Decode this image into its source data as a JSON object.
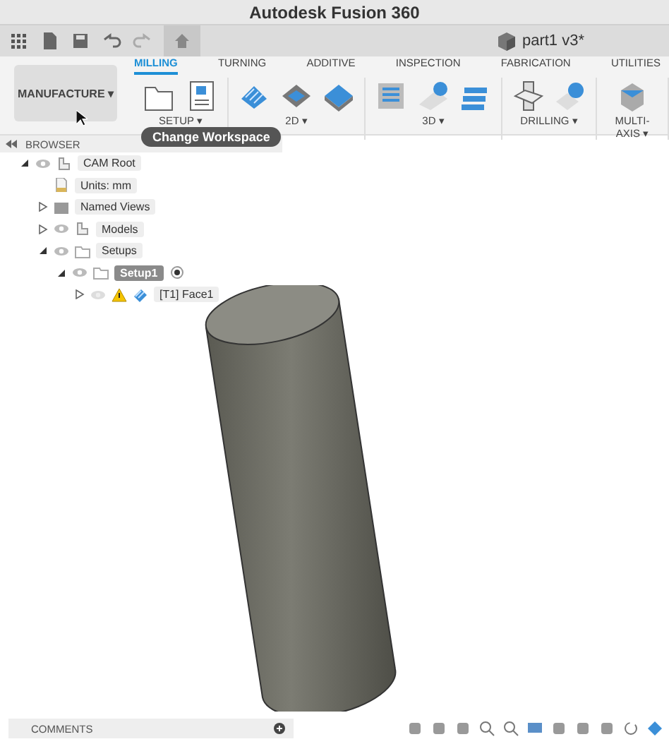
{
  "window": {
    "title": "Autodesk Fusion 360"
  },
  "document": {
    "name": "part1 v3*"
  },
  "workspace": {
    "label": "MANUFACTURE ▾",
    "tooltip": "Change Workspace"
  },
  "tabs": [
    {
      "label": "MILLING",
      "selected": true
    },
    {
      "label": "TURNING",
      "selected": false
    },
    {
      "label": "ADDITIVE",
      "selected": false
    },
    {
      "label": "INSPECTION",
      "selected": false
    },
    {
      "label": "FABRICATION",
      "selected": false
    },
    {
      "label": "UTILITIES",
      "selected": false
    }
  ],
  "groups": [
    {
      "label": "SETUP ▾",
      "tools": [
        {
          "kind": "folder"
        },
        {
          "kind": "gcode"
        }
      ]
    },
    {
      "label": "2D ▾",
      "tools": [
        {
          "kind": "pocket"
        },
        {
          "kind": "contour"
        },
        {
          "kind": "face"
        }
      ]
    },
    {
      "label": "3D ▾",
      "tools": [
        {
          "kind": "adaptive"
        },
        {
          "kind": "flat"
        },
        {
          "kind": "steep"
        }
      ]
    },
    {
      "label": "DRILLING ▾",
      "tools": [
        {
          "kind": "drill"
        },
        {
          "kind": "hole"
        }
      ]
    },
    {
      "label": "MULTI-AXIS ▾",
      "tools": [
        {
          "kind": "swarf"
        }
      ]
    }
  ],
  "browser": {
    "title": "BROWSER",
    "tree": [
      {
        "label": "CAM Root",
        "kind": "root",
        "expanded": true,
        "visible": true,
        "children": [
          {
            "label": "Units: mm",
            "kind": "units"
          },
          {
            "label": "Named Views",
            "kind": "views",
            "expanded": false
          },
          {
            "label": "Models",
            "kind": "models",
            "expanded": false,
            "visible": true
          },
          {
            "label": "Setups",
            "kind": "folder",
            "expanded": true,
            "visible": true,
            "children": [
              {
                "label": "Setup1",
                "kind": "setup",
                "expanded": true,
                "visible": true,
                "selected": true,
                "children": [
                  {
                    "label": "[T1] Face1",
                    "kind": "operation",
                    "expanded": false,
                    "visible": false,
                    "warning": true
                  }
                ]
              }
            ]
          }
        ]
      }
    ]
  },
  "comments": {
    "title": "COMMENTS"
  }
}
